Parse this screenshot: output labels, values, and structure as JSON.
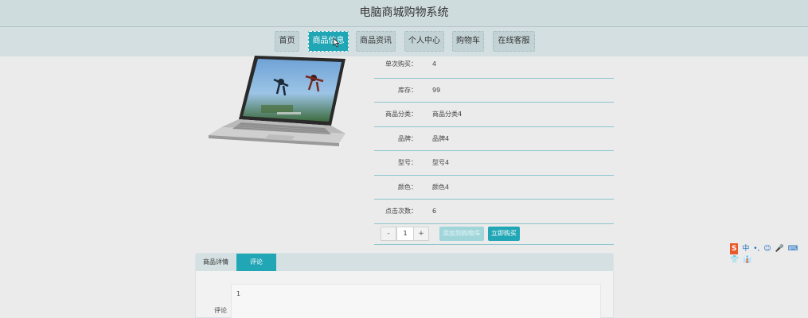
{
  "header": {
    "title": "电脑商城购物系统"
  },
  "nav": {
    "items": [
      {
        "label": "首页"
      },
      {
        "label": "商品信息"
      },
      {
        "label": "商品资讯"
      },
      {
        "label": "个人中心"
      },
      {
        "label": "购物车"
      },
      {
        "label": "在线客服"
      }
    ],
    "active_index": 1
  },
  "product": {
    "image_icon": "laptop-image",
    "details": [
      {
        "label": "单次购买：",
        "value": "4"
      },
      {
        "label": "库存：",
        "value": "99"
      },
      {
        "label": "商品分类：",
        "value": "商品分类4"
      },
      {
        "label": "品牌：",
        "value": "品牌4"
      },
      {
        "label": "型号：",
        "value": "型号4"
      },
      {
        "label": "颜色：",
        "value": "颜色4"
      },
      {
        "label": "点击次数：",
        "value": "6"
      }
    ],
    "quantity": {
      "minus": "-",
      "value": "1",
      "plus": "+"
    },
    "add_to_cart_label": "添加到购物车",
    "buy_now_label": "立即购买"
  },
  "tabs": {
    "items": [
      {
        "label": "商品详情"
      },
      {
        "label": "评论"
      }
    ],
    "active_index": 1
  },
  "comment": {
    "value": "1",
    "label": "评论"
  },
  "ime": {
    "items": [
      "S",
      "中",
      "•,",
      "☺",
      "🎤",
      "⌨",
      "👕",
      "👔"
    ]
  },
  "colors": {
    "accent": "#21a6b5",
    "header_bg": "#cfdcde",
    "page_bg": "#ebebeb"
  }
}
